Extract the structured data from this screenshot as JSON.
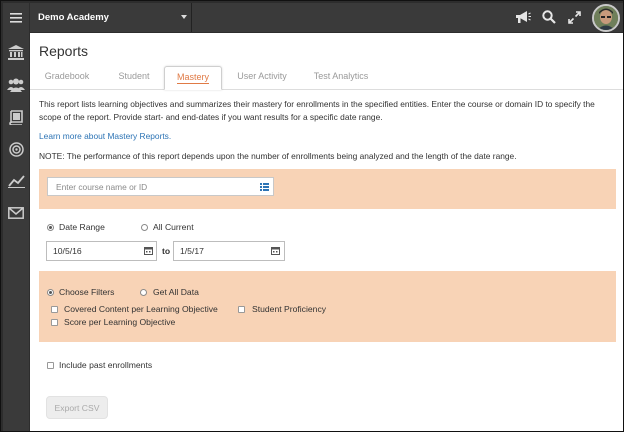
{
  "topbar": {
    "org_name": "Demo Academy",
    "icons": [
      "announcement-icon",
      "search-icon",
      "expand-icon",
      "user-avatar"
    ]
  },
  "sidebar": {
    "items": [
      {
        "icon": "menu-icon"
      },
      {
        "icon": "institution-icon"
      },
      {
        "icon": "users-icon"
      },
      {
        "icon": "book-icon"
      },
      {
        "icon": "target-icon"
      },
      {
        "icon": "analytics-icon"
      },
      {
        "icon": "mail-icon"
      }
    ]
  },
  "page": {
    "title": "Reports",
    "tabs": [
      {
        "label": "Gradebook",
        "active": false
      },
      {
        "label": "Student",
        "active": false
      },
      {
        "label": "Mastery",
        "active": true
      },
      {
        "label": "User Activity",
        "active": false
      },
      {
        "label": "Test Analytics",
        "active": false
      }
    ],
    "intro": "This report lists learning objectives and summarizes their mastery for enrollments in the specified entities. Enter the course or domain ID to specify the scope of the report. Provide start- and end-dates if you want results for a specific date range.",
    "learn_more": "Learn more about Mastery Reports.",
    "note": "NOTE: The performance of this report depends upon the number of enrollments being analyzed and the length of the date range."
  },
  "course": {
    "placeholder": "Enter course name or ID",
    "value": ""
  },
  "date": {
    "option_range": "Date Range",
    "option_all": "All Current",
    "selected": "Date Range",
    "start": "10/5/16",
    "to_label": "to",
    "end": "1/5/17"
  },
  "filters": {
    "option_choose": "Choose Filters",
    "option_all": "Get All Data",
    "selected": "Choose Filters",
    "checks": [
      {
        "label": "Covered Content per Learning Objective",
        "checked": false
      },
      {
        "label": "Student Proficiency",
        "checked": false
      },
      {
        "label": "Score per Learning Objective",
        "checked": false
      }
    ]
  },
  "past_enrollments": {
    "label": "Include past enrollments",
    "checked": false
  },
  "export": {
    "label": "Export CSV",
    "enabled": false
  },
  "colors": {
    "accent": "#e07a45",
    "panel_highlight": "#f8d3b6",
    "link": "#2d74b5",
    "chrome": "#3a3a3a"
  }
}
